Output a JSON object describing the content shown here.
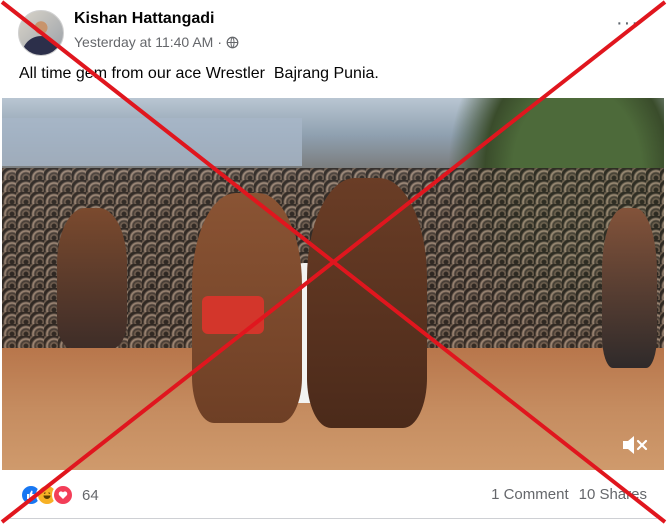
{
  "post": {
    "author": "Kishan Hattangadi",
    "timestamp": "Yesterday at 11:40 AM",
    "separator": "·",
    "privacy_icon": "globe-icon",
    "more_label": "···",
    "text": "All time gem from our ace Wrestler  Bajrang Punia."
  },
  "media": {
    "type": "video",
    "mute_icon": "speaker-muted-icon"
  },
  "engagement": {
    "reaction_icons": [
      "like-icon",
      "haha-icon",
      "love-icon"
    ],
    "reaction_count": "64",
    "comments": "1 Comment",
    "shares": "10 Shares"
  },
  "overlay": {
    "cross_color": "#e0161e"
  },
  "colors": {
    "like": "#1877f2",
    "haha": "#f7b125",
    "love": "#f33e58",
    "secondary_text": "#65676b"
  }
}
